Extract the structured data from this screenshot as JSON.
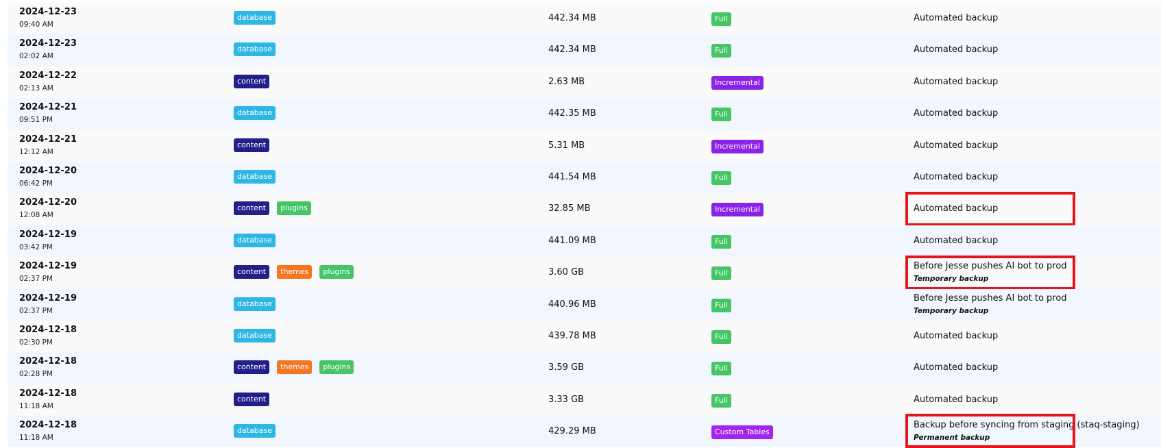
{
  "colors": {
    "database": "#2eb7e4",
    "content": "#221f8a",
    "themes": "#f47621",
    "plugins": "#45c566",
    "Full": "#45c566",
    "Incremental": "#8a22e8",
    "Custom Tables": "#a325ec",
    "highlight": "#e8141b"
  },
  "rows": [
    {
      "date": "2024-12-23",
      "time": "09:40 AM",
      "tags": [
        "database"
      ],
      "size": "442.34 MB",
      "type": "Full",
      "note": "Automated backup",
      "sub": "",
      "highlight": false
    },
    {
      "date": "2024-12-23",
      "time": "02:02 AM",
      "tags": [
        "database"
      ],
      "size": "442.34 MB",
      "type": "Full",
      "note": "Automated backup",
      "sub": "",
      "highlight": false
    },
    {
      "date": "2024-12-22",
      "time": "02:13 AM",
      "tags": [
        "content"
      ],
      "size": "2.63 MB",
      "type": "Incremental",
      "note": "Automated backup",
      "sub": "",
      "highlight": false
    },
    {
      "date": "2024-12-21",
      "time": "09:51 PM",
      "tags": [
        "database"
      ],
      "size": "442.35 MB",
      "type": "Full",
      "note": "Automated backup",
      "sub": "",
      "highlight": false
    },
    {
      "date": "2024-12-21",
      "time": "12:12 AM",
      "tags": [
        "content"
      ],
      "size": "5.31 MB",
      "type": "Incremental",
      "note": "Automated backup",
      "sub": "",
      "highlight": false
    },
    {
      "date": "2024-12-20",
      "time": "06:42 PM",
      "tags": [
        "database"
      ],
      "size": "441.54 MB",
      "type": "Full",
      "note": "Automated backup",
      "sub": "",
      "highlight": false
    },
    {
      "date": "2024-12-20",
      "time": "12:08 AM",
      "tags": [
        "content",
        "plugins"
      ],
      "size": "32.85 MB",
      "type": "Incremental",
      "note": "Automated backup",
      "sub": "",
      "highlight": true
    },
    {
      "date": "2024-12-19",
      "time": "03:42 PM",
      "tags": [
        "database"
      ],
      "size": "441.09 MB",
      "type": "Full",
      "note": "Automated backup",
      "sub": "",
      "highlight": false
    },
    {
      "date": "2024-12-19",
      "time": "02:37 PM",
      "tags": [
        "content",
        "themes",
        "plugins"
      ],
      "size": "3.60 GB",
      "type": "Full",
      "note": "Before Jesse pushes AI bot to prod",
      "sub": "Temporary backup",
      "highlight": true
    },
    {
      "date": "2024-12-19",
      "time": "02:37 PM",
      "tags": [
        "database"
      ],
      "size": "440.96 MB",
      "type": "Full",
      "note": "Before Jesse pushes AI bot to prod",
      "sub": "Temporary backup",
      "highlight": false
    },
    {
      "date": "2024-12-18",
      "time": "02:30 PM",
      "tags": [
        "database"
      ],
      "size": "439.78 MB",
      "type": "Full",
      "note": "Automated backup",
      "sub": "",
      "highlight": false
    },
    {
      "date": "2024-12-18",
      "time": "02:28 PM",
      "tags": [
        "content",
        "themes",
        "plugins"
      ],
      "size": "3.59 GB",
      "type": "Full",
      "note": "Automated backup",
      "sub": "",
      "highlight": false
    },
    {
      "date": "2024-12-18",
      "time": "11:18 AM",
      "tags": [
        "content"
      ],
      "size": "3.33 GB",
      "type": "Full",
      "note": "Automated backup",
      "sub": "",
      "highlight": false
    },
    {
      "date": "2024-12-18",
      "time": "11:18 AM",
      "tags": [
        "database"
      ],
      "size": "429.29 MB",
      "type": "Custom Tables",
      "note": "Backup before syncing from staging (staq-staging)",
      "sub": "Permanent backup",
      "highlight": true
    }
  ]
}
